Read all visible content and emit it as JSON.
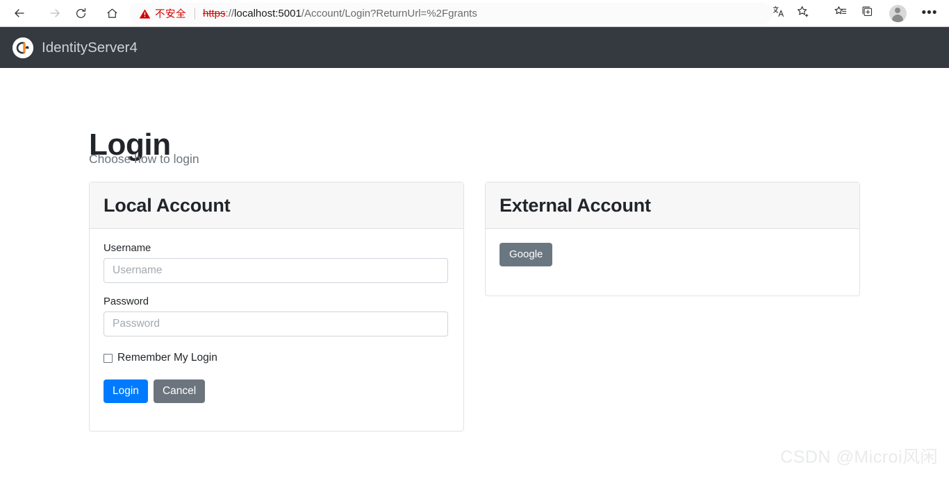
{
  "browser": {
    "back_icon": "back-arrow-icon",
    "forward_icon": "forward-arrow-icon",
    "reload_icon": "reload-icon",
    "home_icon": "home-icon",
    "security_label": "不安全",
    "url": {
      "scheme": "https",
      "separator": "://",
      "host": "localhost:5001",
      "rest": "/Account/Login?ReturnUrl=%2Fgrants",
      "full": "https://localhost:5001/Account/Login?ReturnUrl=%2Fgrants"
    },
    "warning_color": "#d40000",
    "icons": {
      "translate": "translate-icon",
      "favorite_add": "star-plus-icon",
      "favorites_list": "favorites-list-icon",
      "collections": "collections-icon",
      "profile": "profile-avatar-icon",
      "settings": "more-options-icon"
    },
    "settings_glyph": "•••"
  },
  "navbar": {
    "brand": "IdentityServer4",
    "background": "#343a40",
    "brand_color": "#ced2d6",
    "logo_icon": "identityserver-logo-icon"
  },
  "page": {
    "title": "Login",
    "subtitle": "Choose how to login"
  },
  "local_account": {
    "header": "Local Account",
    "username_label": "Username",
    "username_placeholder": "Username",
    "username_value": "",
    "password_label": "Password",
    "password_placeholder": "Password",
    "password_value": "",
    "remember_label": "Remember My Login",
    "remember_checked": false,
    "login_button": "Login",
    "cancel_button": "Cancel",
    "login_color": "#007bff",
    "cancel_color": "#6c757d"
  },
  "external_account": {
    "header": "External Account",
    "providers": [
      {
        "label": "Google",
        "color": "#6b7780"
      }
    ]
  },
  "watermark": {
    "text": "CSDN @Microi风闲"
  }
}
